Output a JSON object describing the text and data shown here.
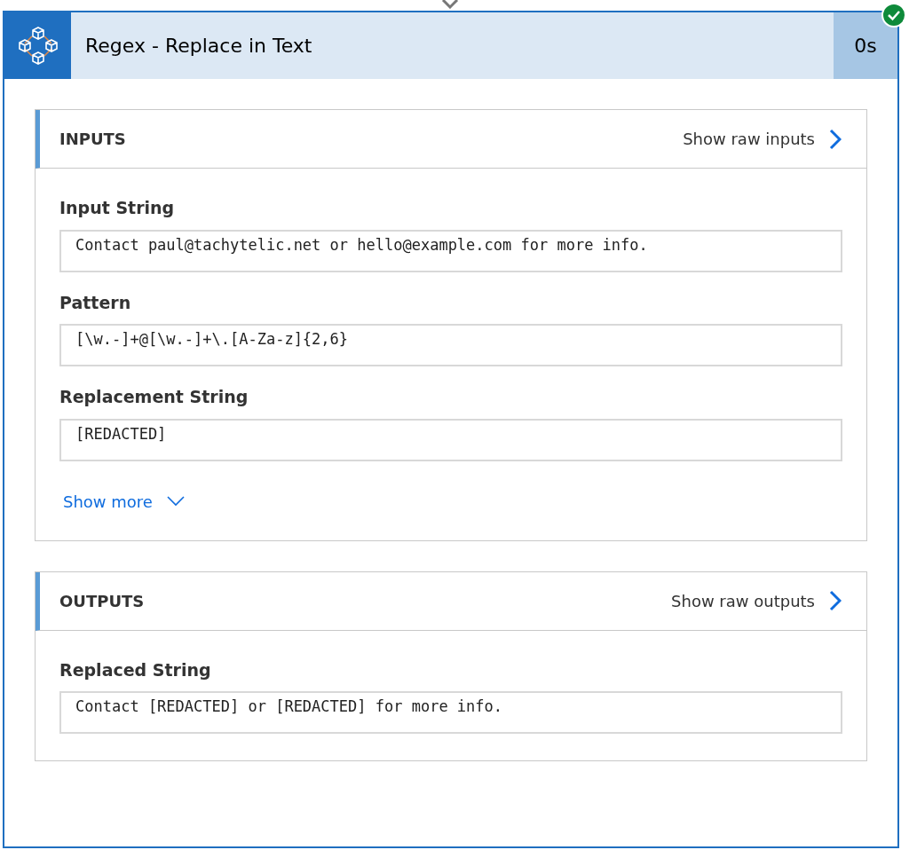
{
  "action": {
    "title": "Regex - Replace in Text",
    "duration": "0s",
    "succeeded": true
  },
  "sections": [
    {
      "title": "INPUTS",
      "raw_link": "Show raw inputs",
      "fields": [
        {
          "label": "Input String",
          "value": "Contact paul@tachytelic.net or hello@example.com for more info."
        },
        {
          "label": "Pattern",
          "value": "[\\w.-]+@[\\w.-]+\\.[A-Za-z]{2,6}"
        },
        {
          "label": "Replacement String",
          "value": "[REDACTED]"
        }
      ],
      "show_more": "Show more"
    },
    {
      "title": "OUTPUTS",
      "raw_link": "Show raw outputs",
      "fields": [
        {
          "label": "Replaced String",
          "value": "Contact [REDACTED] or [REDACTED] for more info."
        }
      ]
    }
  ]
}
